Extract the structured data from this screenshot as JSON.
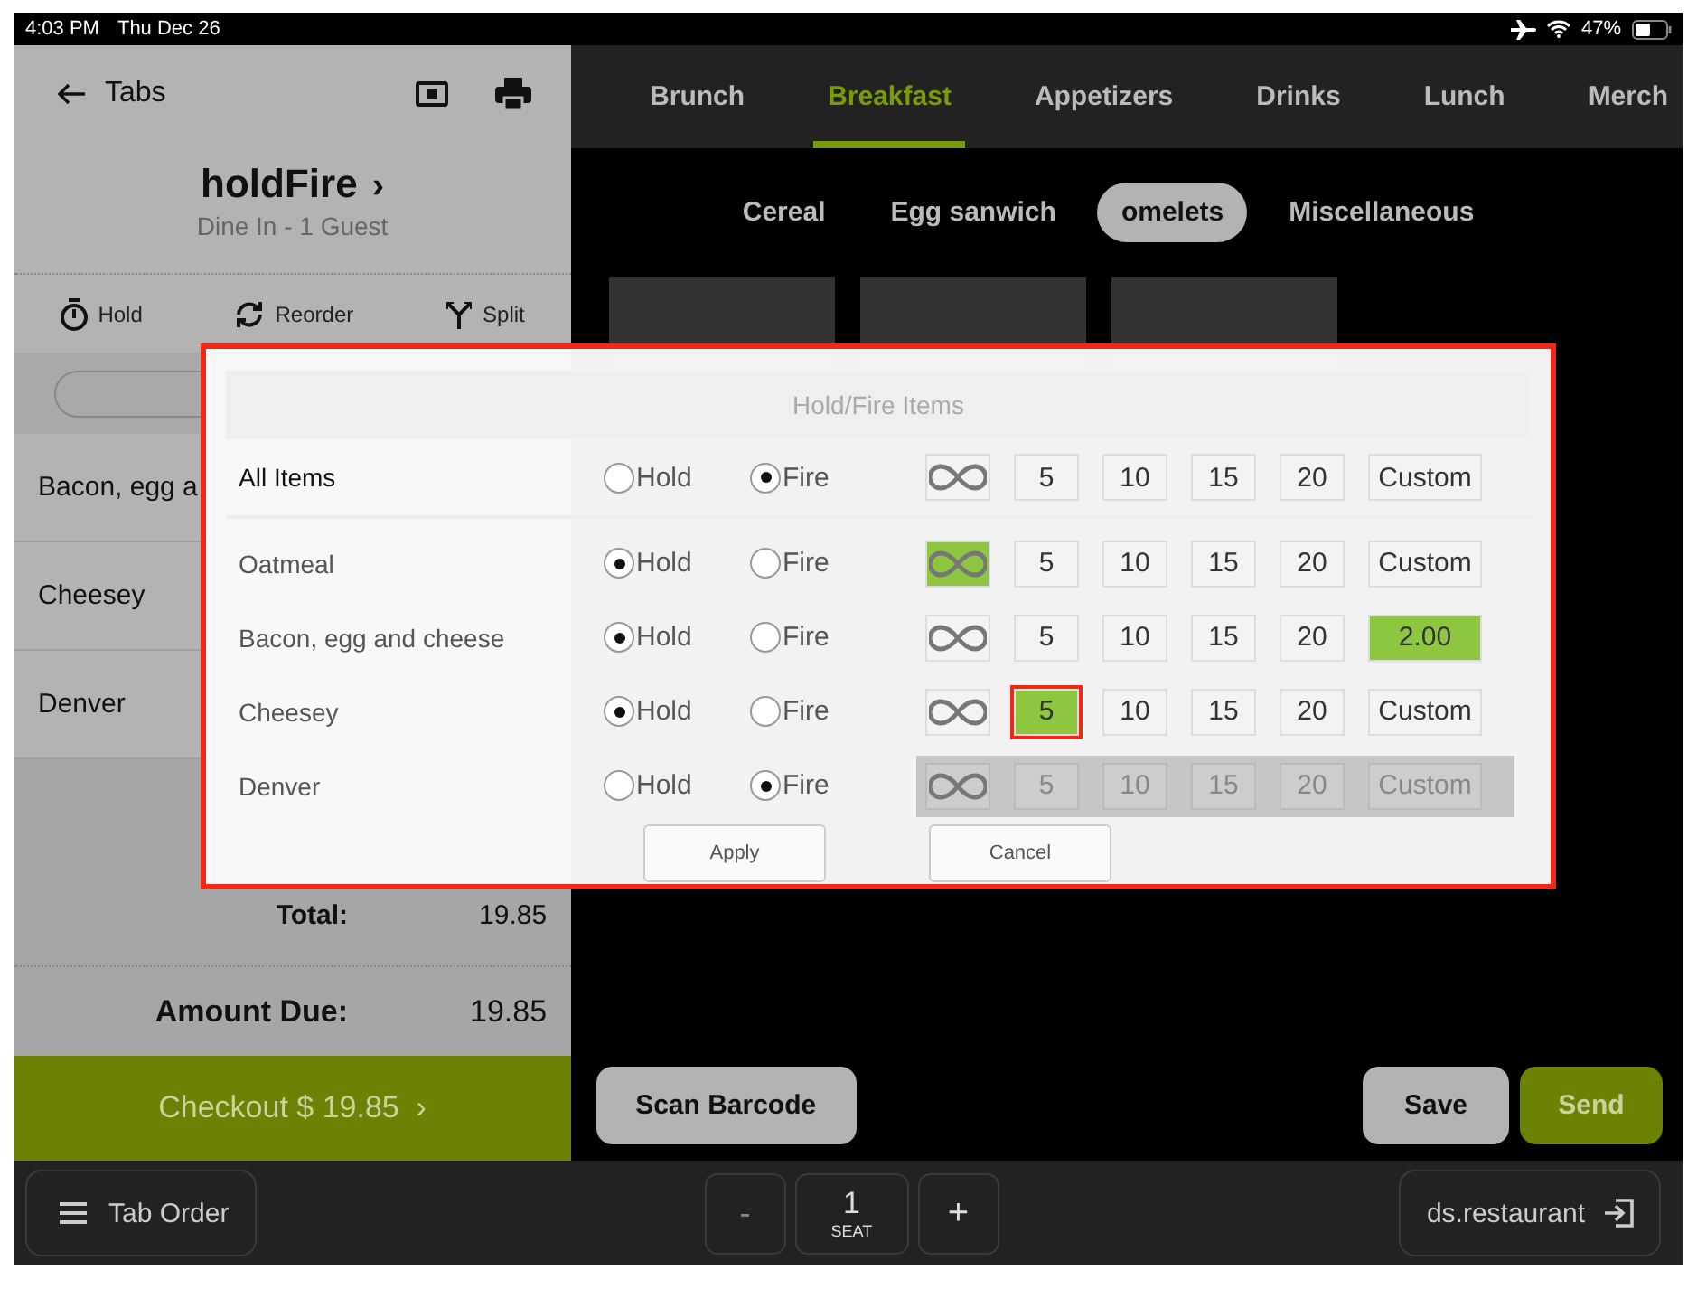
{
  "status_bar": {
    "time": "4:03 PM",
    "date": "Thu Dec 26",
    "battery": "47%"
  },
  "order_panel": {
    "back": "Tabs",
    "title": "holdFire",
    "chevron": "›",
    "subtitle": "Dine In - 1 Guest",
    "actions": [
      "Hold",
      "Reorder",
      "Split"
    ],
    "items": [
      "Bacon, egg a",
      "Cheesey",
      "Denver"
    ],
    "total_label": "Total:",
    "total": "19.85",
    "due_label": "Amount Due:",
    "due": "19.85",
    "checkout": "Checkout $ 19.85",
    "checkout_chevron": "›"
  },
  "menu_tabs": [
    {
      "label": "Brunch",
      "selected": false
    },
    {
      "label": "Breakfast",
      "selected": true
    },
    {
      "label": "Appetizers",
      "selected": false
    },
    {
      "label": "Drinks",
      "selected": false
    },
    {
      "label": "Lunch",
      "selected": false
    },
    {
      "label": "Merch",
      "selected": false
    }
  ],
  "subcategories": [
    {
      "label": "Cereal",
      "selected": false
    },
    {
      "label": "Egg sanwich",
      "selected": false
    },
    {
      "label": "omelets",
      "selected": true
    },
    {
      "label": "Miscellaneous",
      "selected": false
    }
  ],
  "dialog": {
    "title": "Hold/Fire Items",
    "rows": [
      {
        "name": "All Items",
        "kind": "all",
        "disabled": false,
        "radios": [
          {
            "label": "Hold",
            "selected": false
          },
          {
            "label": "Fire",
            "selected": true
          }
        ],
        "timers": [
          {
            "kind": "infinite",
            "selected": false,
            "focused": false
          },
          {
            "kind": "value",
            "label": "5",
            "selected": false,
            "focused": false
          },
          {
            "kind": "value",
            "label": "10",
            "selected": false,
            "focused": false
          },
          {
            "kind": "value",
            "label": "15",
            "selected": false,
            "focused": false
          },
          {
            "kind": "value",
            "label": "20",
            "selected": false,
            "focused": false
          },
          {
            "kind": "custom",
            "label": "Custom",
            "selected": false,
            "focused": false
          }
        ]
      },
      {
        "name": "Oatmeal",
        "kind": "item",
        "disabled": false,
        "radios": [
          {
            "label": "Hold",
            "selected": true
          },
          {
            "label": "Fire",
            "selected": false
          }
        ],
        "timers": [
          {
            "kind": "infinite",
            "selected": true,
            "focused": false
          },
          {
            "kind": "value",
            "label": "5",
            "selected": false,
            "focused": false
          },
          {
            "kind": "value",
            "label": "10",
            "selected": false,
            "focused": false
          },
          {
            "kind": "value",
            "label": "15",
            "selected": false,
            "focused": false
          },
          {
            "kind": "value",
            "label": "20",
            "selected": false,
            "focused": false
          },
          {
            "kind": "custom",
            "label": "Custom",
            "selected": false,
            "focused": false
          }
        ]
      },
      {
        "name": "Bacon, egg and cheese",
        "kind": "item",
        "disabled": false,
        "radios": [
          {
            "label": "Hold",
            "selected": true
          },
          {
            "label": "Fire",
            "selected": false
          }
        ],
        "timers": [
          {
            "kind": "infinite",
            "selected": false,
            "focused": false
          },
          {
            "kind": "value",
            "label": "5",
            "selected": false,
            "focused": false
          },
          {
            "kind": "value",
            "label": "10",
            "selected": false,
            "focused": false
          },
          {
            "kind": "value",
            "label": "15",
            "selected": false,
            "focused": false
          },
          {
            "kind": "value",
            "label": "20",
            "selected": false,
            "focused": false
          },
          {
            "kind": "custom",
            "label": "2.00",
            "selected": true,
            "focused": false
          }
        ]
      },
      {
        "name": "Cheesey",
        "kind": "item",
        "disabled": false,
        "radios": [
          {
            "label": "Hold",
            "selected": true
          },
          {
            "label": "Fire",
            "selected": false
          }
        ],
        "timers": [
          {
            "kind": "infinite",
            "selected": false,
            "focused": false
          },
          {
            "kind": "value",
            "label": "5",
            "selected": true,
            "focused": true
          },
          {
            "kind": "value",
            "label": "10",
            "selected": false,
            "focused": false
          },
          {
            "kind": "value",
            "label": "15",
            "selected": false,
            "focused": false
          },
          {
            "kind": "value",
            "label": "20",
            "selected": false,
            "focused": false
          },
          {
            "kind": "custom",
            "label": "Custom",
            "selected": false,
            "focused": false
          }
        ]
      },
      {
        "name": "Denver",
        "kind": "item",
        "disabled": true,
        "radios": [
          {
            "label": "Hold",
            "selected": false
          },
          {
            "label": "Fire",
            "selected": true
          }
        ],
        "timers": [
          {
            "kind": "infinite",
            "selected": false,
            "focused": false
          },
          {
            "kind": "value",
            "label": "5",
            "selected": false,
            "focused": false
          },
          {
            "kind": "value",
            "label": "10",
            "selected": false,
            "focused": false
          },
          {
            "kind": "value",
            "label": "15",
            "selected": false,
            "focused": false
          },
          {
            "kind": "value",
            "label": "20",
            "selected": false,
            "focused": false
          },
          {
            "kind": "custom",
            "label": "Custom",
            "selected": false,
            "focused": false
          }
        ]
      }
    ],
    "buttons": [
      "Apply",
      "Cancel"
    ]
  },
  "actions": {
    "scan": "Scan Barcode",
    "save": "Save",
    "send": "Send"
  },
  "bottom_bar": {
    "tab_order": "Tab Order",
    "minus": "-",
    "seat_count": "1",
    "seat_label": "SEAT",
    "plus": "+",
    "user": "ds.restaurant"
  }
}
